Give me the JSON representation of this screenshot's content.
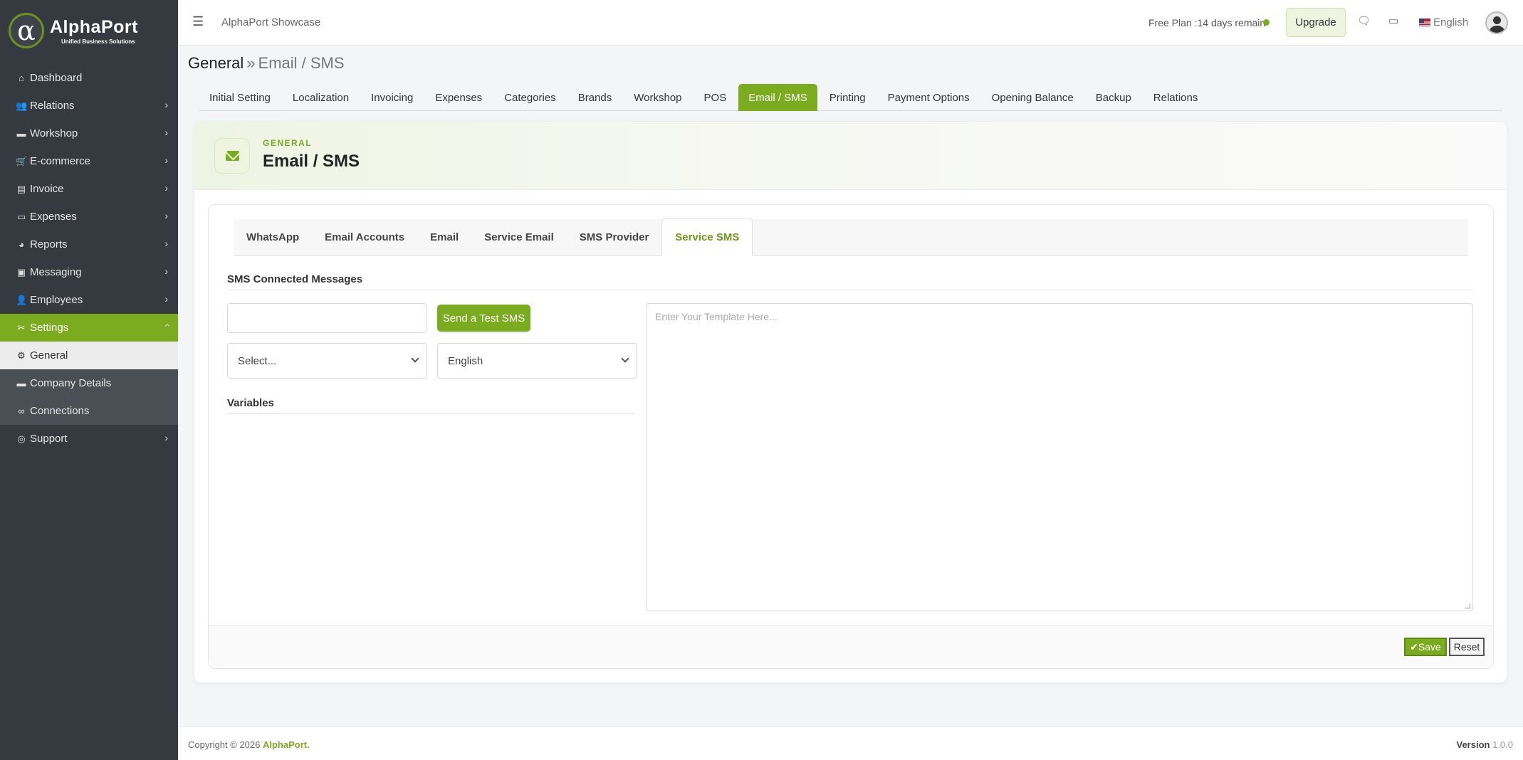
{
  "brand": {
    "name": "AlphaPort",
    "tagline": "Unified Business Solutions",
    "logo_glyph": "α"
  },
  "header": {
    "app_title": "AlphaPort Showcase",
    "plan_text": "Free Plan :14 days remain",
    "upgrade_label": "Upgrade",
    "language": "English"
  },
  "sidebar": {
    "items": [
      {
        "label": "Dashboard",
        "icon": "home-icon"
      },
      {
        "label": "Relations",
        "icon": "users-icon"
      },
      {
        "label": "Workshop",
        "icon": "toolbox-icon"
      },
      {
        "label": "E-commerce",
        "icon": "cart-icon"
      },
      {
        "label": "Invoice",
        "icon": "file-icon"
      },
      {
        "label": "Expenses",
        "icon": "money-icon"
      },
      {
        "label": "Reports",
        "icon": "pie-chart-icon"
      },
      {
        "label": "Messaging",
        "icon": "comment-icon"
      },
      {
        "label": "Employees",
        "icon": "user-group-icon"
      },
      {
        "label": "Settings",
        "icon": "tools-icon"
      }
    ],
    "sub_items": [
      {
        "label": "General",
        "icon": "gear-icon"
      },
      {
        "label": "Company Details",
        "icon": "briefcase-icon"
      },
      {
        "label": "Connections",
        "icon": "link-icon"
      }
    ],
    "support": {
      "label": "Support",
      "icon": "lifebuoy-icon"
    }
  },
  "breadcrumb": {
    "parent": "General",
    "separator": "»",
    "current": "Email / SMS"
  },
  "settings_tabs": [
    "Initial Setting",
    "Localization",
    "Invoicing",
    "Expenses",
    "Categories",
    "Brands",
    "Workshop",
    "POS",
    "Email / SMS",
    "Printing",
    "Payment Options",
    "Opening Balance",
    "Backup",
    "Relations"
  ],
  "card": {
    "kicker": "GENERAL",
    "title": "Email / SMS"
  },
  "sub_tabs": [
    "WhatsApp",
    "Email Accounts",
    "Email",
    "Service Email",
    "SMS Provider",
    "Service SMS"
  ],
  "form": {
    "section_title": "SMS Connected Messages",
    "phone_value": "",
    "test_button": "Send a Test SMS",
    "event_select": "Select...",
    "language_select": "English",
    "variables_title": "Variables",
    "template_placeholder": "Enter Your Template Here..."
  },
  "actions": {
    "save": "Save",
    "reset": "Reset"
  },
  "footer": {
    "copyright_prefix": "Copyright © 2026",
    "brand": "AlphaPort.",
    "version_label": "Version",
    "version_value": "1.0.0"
  },
  "colors": {
    "accent": "#7bab1f",
    "sidebar_bg": "#343a40"
  }
}
